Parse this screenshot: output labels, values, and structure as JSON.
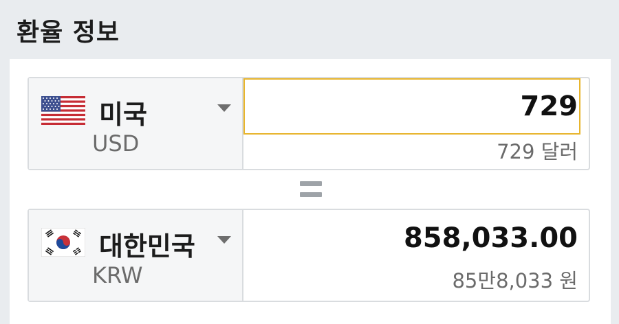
{
  "header": {
    "title": "환율 정보"
  },
  "from": {
    "country": "미국",
    "code": "USD",
    "flag_icon": "us-flag",
    "amount": "729",
    "amount_words": "729 달러"
  },
  "to": {
    "country": "대한민국",
    "code": "KRW",
    "flag_icon": "kr-flag",
    "amount": "858,033.00",
    "amount_words": "85만8,033 원"
  },
  "colors": {
    "input_focus": "#e8b52d",
    "border": "#d9dcdf",
    "page_bg": "#e9ecef"
  }
}
